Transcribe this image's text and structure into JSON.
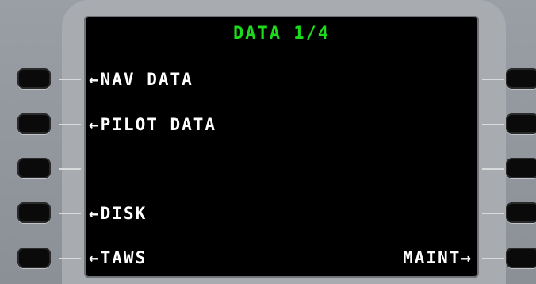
{
  "page": {
    "title": "DATA 1/4"
  },
  "left_lsk": [
    {
      "label": "←NAV DATA"
    },
    {
      "label": "←PILOT DATA"
    },
    {
      "label": ""
    },
    {
      "label": "←DISK"
    },
    {
      "label": "←TAWS"
    }
  ],
  "right_lsk": [
    {
      "label": ""
    },
    {
      "label": ""
    },
    {
      "label": ""
    },
    {
      "label": ""
    },
    {
      "label": "MAINT→"
    }
  ],
  "colors": {
    "title": "#1bdc1b",
    "text": "#ffffff",
    "screen": "#000000",
    "bezel": "#9a9ea5"
  }
}
